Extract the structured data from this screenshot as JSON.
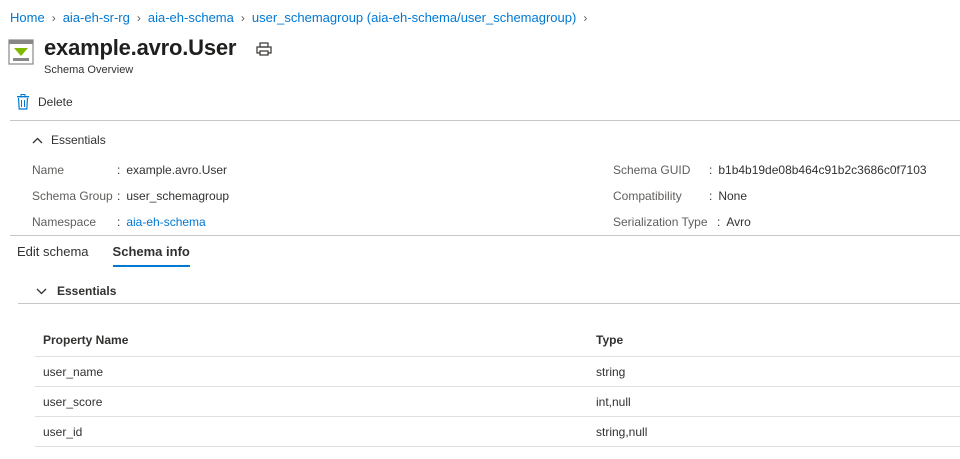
{
  "breadcrumb": {
    "home": "Home",
    "rg": "aia-eh-sr-rg",
    "schema": "aia-eh-schema",
    "group": "user_schemagroup (aia-eh-schema/user_schemagroup)"
  },
  "header": {
    "title": "example.avro.User",
    "subtitle": "Schema Overview"
  },
  "toolbar": {
    "delete_label": "Delete"
  },
  "essentials": {
    "heading": "Essentials",
    "left": [
      {
        "key": "Name",
        "value": "example.avro.User"
      },
      {
        "key": "Schema Group",
        "value": "user_schemagroup"
      },
      {
        "key": "Namespace",
        "value": "aia-eh-schema"
      }
    ],
    "right": [
      {
        "key": "Schema GUID",
        "value": "b1b4b19de08b464c91b2c3686c0f7103"
      },
      {
        "key": "Compatibility",
        "value": "None"
      },
      {
        "key": "Serialization Type",
        "value": "Avro"
      }
    ]
  },
  "tabs": [
    {
      "label": "Edit schema"
    },
    {
      "label": "Schema info"
    }
  ],
  "schema_info": {
    "heading": "Essentials",
    "columns": [
      "Property Name",
      "Type"
    ],
    "rows": [
      [
        "user_name",
        "string"
      ],
      [
        "user_score",
        "int,null"
      ],
      [
        "user_id",
        "string,null"
      ]
    ]
  },
  "colors": {
    "accent": "#0078d4",
    "icon_green": "#7fba00"
  }
}
